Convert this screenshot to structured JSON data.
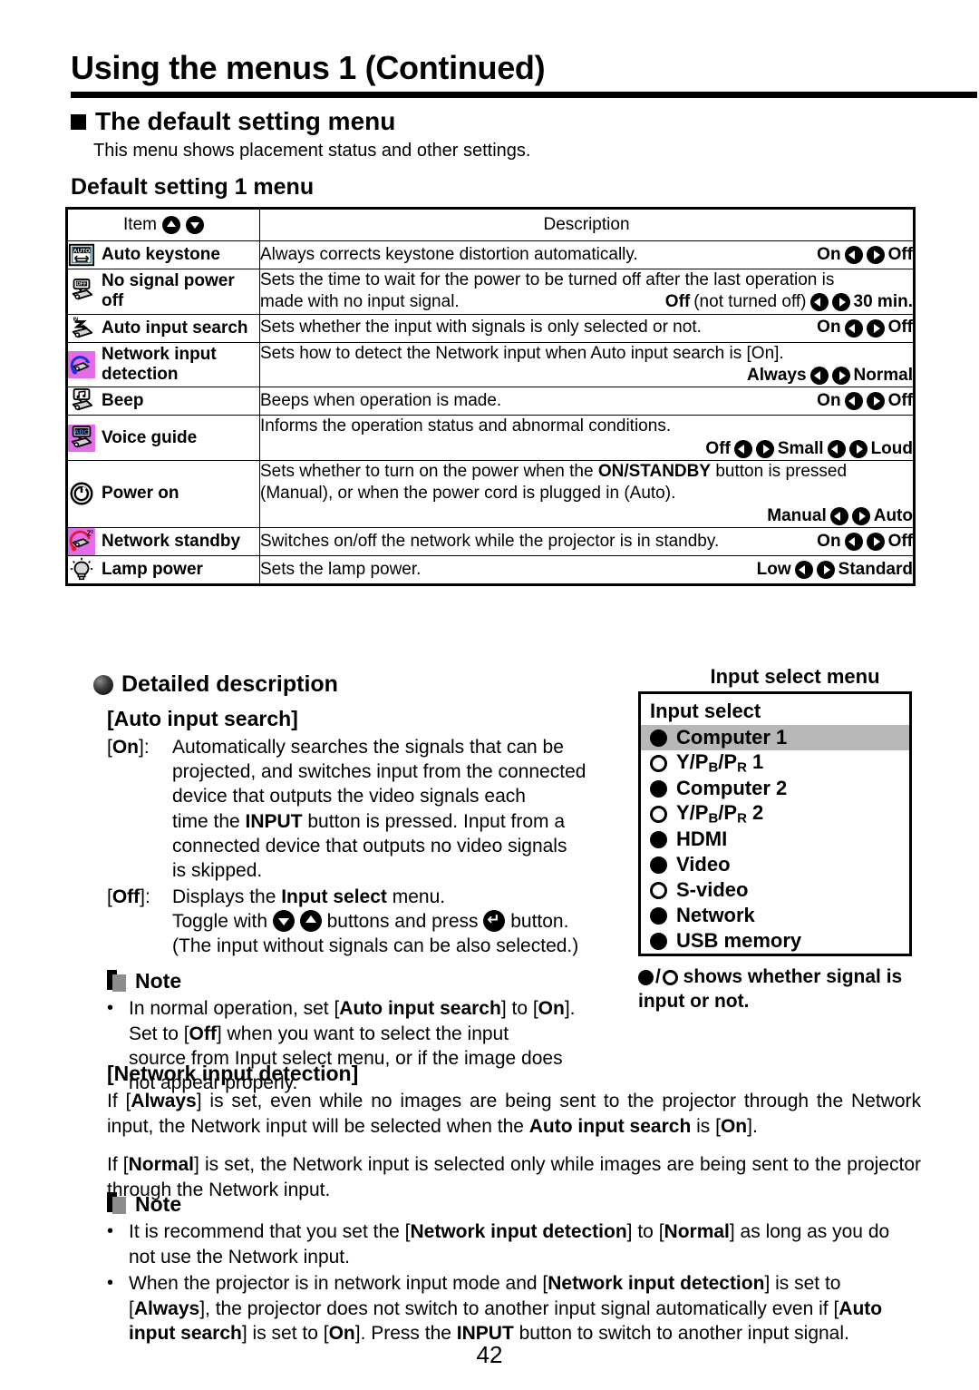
{
  "header": {
    "chapter_title": "Using the menus 1 (Continued)",
    "section_heading": "The default setting menu",
    "section_intro": "This menu shows placement status and other settings.",
    "table_title": "Default setting 1 menu"
  },
  "table": {
    "columns": {
      "item": "Item",
      "description": "Description"
    },
    "rows": [
      {
        "icon": "auto-keystone-icon",
        "item": "Auto keystone",
        "description": "Always corrects keystone distortion automatically.",
        "options_inline": true,
        "options": [
          "On",
          "Off"
        ]
      },
      {
        "icon": "no-signal-power-off-icon",
        "item": "No signal power off",
        "description_line1": "Sets the time to wait for the power to be turned off after the last operation is",
        "description_line2": "made with no input signal.",
        "options": [
          "Off",
          "30 min."
        ],
        "option_note": "(not turned off)"
      },
      {
        "icon": "auto-input-search-icon",
        "item": "Auto input search",
        "description": "Sets whether the input with signals is only selected or not.",
        "options_inline": true,
        "options": [
          "On",
          "Off"
        ]
      },
      {
        "icon": "network-input-detection-icon",
        "item": "Network input detection",
        "description_line1": "Sets how to detect the Network input when Auto input search is [On].",
        "options": [
          "Always",
          "Normal"
        ]
      },
      {
        "icon": "beep-icon",
        "item": "Beep",
        "description": "Beeps when operation is made.",
        "options_inline": true,
        "options": [
          "On",
          "Off"
        ]
      },
      {
        "icon": "voice-guide-icon",
        "item": "Voice guide",
        "description_line1": "Informs the operation status and abnormal conditions.",
        "options": [
          "Off",
          "Small",
          "Loud"
        ]
      },
      {
        "icon": "power-on-icon",
        "item": "Power on",
        "description_line1": "Sets whether to turn on the power when the ON/STANDBY button is pressed",
        "description_line2": "(Manual), or when the power cord is plugged in (Auto).",
        "options": [
          "Manual",
          "Auto"
        ]
      },
      {
        "icon": "network-standby-icon",
        "item": "Network standby",
        "description": "Switches on/off the network while the projector is in standby.",
        "options_inline": true,
        "options": [
          "On",
          "Off"
        ]
      },
      {
        "icon": "lamp-power-icon",
        "item": "Lamp power",
        "description": "Sets the lamp power.",
        "options_inline": true,
        "options": [
          "Low",
          "Standard"
        ]
      }
    ]
  },
  "detailed": {
    "heading": "Detailed description",
    "auto_input_search": {
      "title": "[Auto input search]",
      "on_tag": "[On]:",
      "on_text_1": "Automatically searches the signals that can be",
      "on_text_2": "projected, and switches input from the connected",
      "on_text_3": "device that outputs the video signals each",
      "on_text_4_a": "time the ",
      "on_text_4_b": "INPUT",
      "on_text_4_c": " button is pressed. Input from a",
      "on_text_5": "connected device that outputs no video signals",
      "on_text_6": "is skipped.",
      "off_tag": "[Off]:",
      "off_text_1_a": "Displays the ",
      "off_text_1_b": "Input select",
      "off_text_1_c": " menu.",
      "off_text_2_a": "Toggle with ",
      "off_text_2_b": " buttons and press ",
      "off_text_2_c": " button.",
      "off_text_3": "(The input without signals can be also selected.)"
    },
    "note1": {
      "title": "Note",
      "bullet_1_a": "In normal operation, set [",
      "bullet_1_b": "Auto input search",
      "bullet_1_c": "] to [",
      "bullet_1_d": "On",
      "bullet_1_e": "].",
      "bullet_1_f": "Set to [",
      "bullet_1_g": "Off",
      "bullet_1_h": "] when you want to select the input",
      "bullet_1_i": "source from Input select menu, or if the image does",
      "bullet_1_j": "not appear properly."
    }
  },
  "input_select_menu": {
    "caption": "Input select menu",
    "panel_label": "Input select",
    "items": [
      {
        "label": "Computer 1",
        "signal": true,
        "selected": true
      },
      {
        "label": "Y/PB/PR 1",
        "base": "Y/P",
        "sub1": "B",
        "mid": "/P",
        "sub2": "R",
        "tail": " 1",
        "signal": false,
        "selected": false
      },
      {
        "label": "Computer 2",
        "signal": true,
        "selected": false
      },
      {
        "label": "Y/PB/PR 2",
        "base": "Y/P",
        "sub1": "B",
        "mid": "/P",
        "sub2": "R",
        "tail": " 2",
        "signal": false,
        "selected": false
      },
      {
        "label": "HDMI",
        "signal": true,
        "selected": false
      },
      {
        "label": "Video",
        "signal": true,
        "selected": false
      },
      {
        "label": "S-video",
        "signal": false,
        "selected": false
      },
      {
        "label": "Network",
        "signal": true,
        "selected": false
      },
      {
        "label": "USB memory",
        "signal": true,
        "selected": false
      }
    ],
    "legend_1": " shows whether signal is",
    "legend_2": "input or not."
  },
  "network_input_detection": {
    "title": "[Network input detection]",
    "para1_a": "If [",
    "para1_b": "Always",
    "para1_c": "] is set, even while no images are being sent to the projector through the Network input, the Network input will be selected when the ",
    "para1_d": "Auto input search",
    "para1_e": " is [",
    "para1_f": "On",
    "para1_g": "].",
    "para2_a": "If [",
    "para2_b": "Normal",
    "para2_c": "] is set, the Network input is selected only while images are being sent to the projector through the Network input."
  },
  "note2": {
    "title": "Note",
    "b1_a": "It is recommend that you set the [",
    "b1_b": "Network input detection",
    "b1_c": "] to [",
    "b1_d": "Normal",
    "b1_e": "] as long as you do not use the Network input.",
    "b2_a": "When the projector is in network input mode and [",
    "b2_b": "Network input detection",
    "b2_c": "] is set to [",
    "b2_d": "Always",
    "b2_e": "], the projector does not switch to another input signal automatically even if [",
    "b2_f": "Auto input search",
    "b2_g": "] is set to [",
    "b2_h": "On",
    "b2_i": "]. Press the ",
    "b2_j": "INPUT",
    "b2_k": " button to switch to another input signal."
  },
  "page_number": "42",
  "colors": {
    "icon_violet": "#e46ce8",
    "selection_gray": "#b8b8b8",
    "note_gray": "#8d8d8d"
  }
}
